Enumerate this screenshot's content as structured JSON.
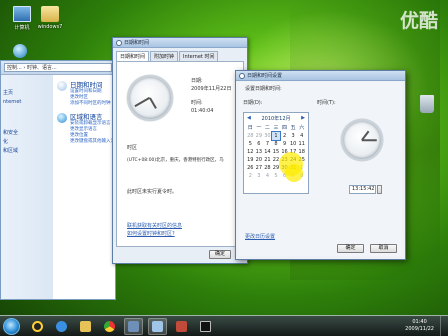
{
  "desktop": {
    "icons": [
      {
        "label": "计算机"
      },
      {
        "label": "windows7"
      }
    ],
    "watermark": "优酷"
  },
  "explorer": {
    "address": "控制... › 时钟、语言...",
    "nav": [
      "主页",
      "nternet",
      "和安全",
      "化",
      "和区域"
    ],
    "items": [
      {
        "title": "日期和时间",
        "links": [
          "设置时间和日期",
          "更改时区",
          "添加不同时区的时钟"
        ]
      },
      {
        "title": "区域和语言",
        "links": [
          "安装或卸载显示语言",
          "更改显示语言",
          "更改位置",
          "更改键盘或其他输入法"
        ]
      }
    ]
  },
  "datetime_window": {
    "title": "日期和时间",
    "tabs": [
      "日期和时间",
      "附加时钟",
      "Internet 时间"
    ],
    "date_label": "日期:",
    "date_value": "2009年11月22日",
    "time_label": "时间:",
    "time_value": "01:40:04",
    "timezone_label": "时区",
    "timezone_value": "(UTC+08:00)北京，重庆，香港特别行政区，乌",
    "dst_note": "此时区未实行夏令时。",
    "links": [
      "联机获取有关时区的信息",
      "如何设置时钟和时区?"
    ],
    "ok_label": "确定"
  },
  "settings_dialog": {
    "title": "日期和时间设置",
    "subtitle": "设置日期和时间:",
    "date_label": "日期(D):",
    "time_label": "时间(T):",
    "month_title": "2010年12月",
    "weekdays": [
      "日",
      "一",
      "二",
      "三",
      "四",
      "五",
      "六"
    ],
    "calendar_rows": [
      [
        "28",
        "29",
        "30",
        "1",
        "2",
        "3",
        "4"
      ],
      [
        "5",
        "6",
        "7",
        "8",
        "9",
        "10",
        "11"
      ],
      [
        "12",
        "13",
        "14",
        "15",
        "16",
        "17",
        "18"
      ],
      [
        "19",
        "20",
        "21",
        "22",
        "23",
        "24",
        "25"
      ],
      [
        "26",
        "27",
        "28",
        "29",
        "30",
        "31",
        "1"
      ],
      [
        "2",
        "3",
        "4",
        "5",
        "6",
        "7",
        "8"
      ]
    ],
    "time_value": "13:15:42",
    "change_calendar_link": "更改日历设置",
    "ok_label": "确定",
    "cancel_label": "取消"
  },
  "taskbar": {
    "tray_time": "01:40",
    "tray_date": "2009/11/22"
  },
  "colors": {
    "highlight": "#ffe800",
    "link": "#2a5db0"
  }
}
